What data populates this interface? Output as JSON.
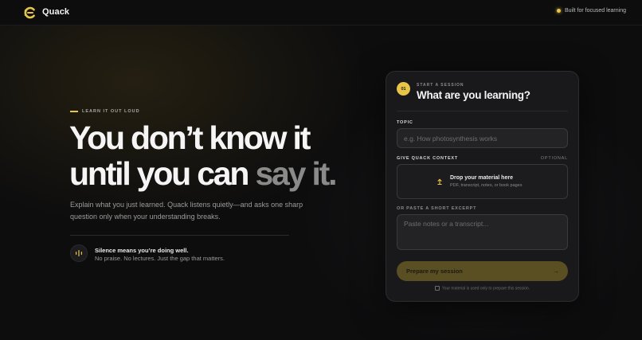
{
  "header": {
    "brand": "Quack",
    "tagline": "Built for focused learning"
  },
  "hero": {
    "eyebrow": "LEARN IT OUT LOUD",
    "headline_line1": "You don’t know it",
    "headline_line2_start": "until you can ",
    "headline_line2_emphasis": "say it.",
    "description": "Explain what you just learned. Quack listens quietly—and asks one sharp question only when your understanding breaks.",
    "quiet_title": "Silence means you’re doing well.",
    "quiet_subtitle": "No praise. No lectures. Just the gap that matters."
  },
  "card": {
    "step_number": "01",
    "eyebrow": "START A SESSION",
    "title": "What are you learning?",
    "topic_label": "TOPIC",
    "topic_placeholder": "e.g. How photosynthesis works",
    "context_label": "GIVE QUACK CONTEXT",
    "context_optional": "OPTIONAL",
    "drop_title": "Drop your material here",
    "drop_subtitle": "PDF, transcript, notes, or book pages",
    "excerpt_label": "OR PASTE A SHORT EXCERPT",
    "excerpt_placeholder": "Paste notes or a transcript...",
    "submit_label": "Prepare my session",
    "submit_arrow": "→",
    "privacy_note": "Your material is used only to prepare this session."
  },
  "colors": {
    "accent": "#e8c547",
    "button_bg": "#5a4e23",
    "background": "#0d0d0e",
    "card_bg": "#19191b"
  },
  "icons": {
    "logo": "quack-logo-icon",
    "status": "status-dot-icon",
    "waveform": "waveform-icon",
    "upload": "upload-icon",
    "arrow": "arrow-right-icon",
    "lock": "lock-icon"
  }
}
